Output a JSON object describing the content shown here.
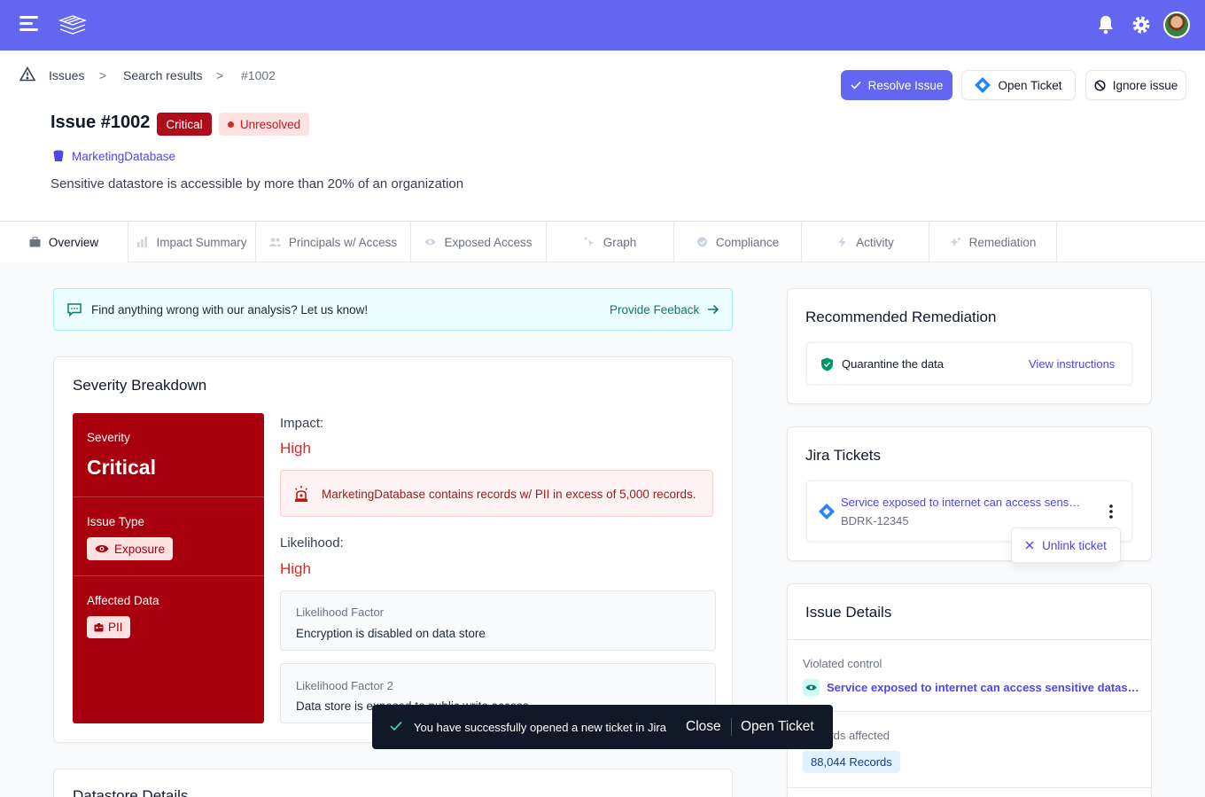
{
  "breadcrumb": {
    "items": [
      "Issues",
      "Search results",
      "#1002"
    ],
    "sep": ">"
  },
  "actions": {
    "resolve": "Resolve Issue",
    "open_ticket": "Open Ticket",
    "ignore": "Ignore issue"
  },
  "issue": {
    "title": "Issue #1002",
    "severity_badge": "Critical",
    "status_badge": "Unresolved",
    "datastore": "MarketingDatabase",
    "description": "Sensitive datastore is accessible by more than 20% of an organization"
  },
  "tabs": [
    "Overview",
    "Impact Summary",
    "Principals w/ Access",
    "Exposed Access",
    "Graph",
    "Compliance",
    "Activity",
    "Remediation"
  ],
  "feedback": {
    "text": "Find anything wrong with our analysis? Let us know!",
    "link": "Provide Feeback"
  },
  "severity": {
    "title": "Severity Breakdown",
    "label": "Severity",
    "value": "Critical",
    "issue_type_label": "Issue Type",
    "issue_type": "Exposure",
    "affected_label": "Affected Data",
    "affected": "PII",
    "impact_label": "Impact:",
    "impact_value": "High",
    "impact_detail": "MarketingDatabase contains records w/ PII in excess of 5,000 records.",
    "likelihood_label": "Likelihood:",
    "likelihood_value": "High",
    "factors": [
      {
        "label": "Likelihood Factor",
        "text": "Encryption is disabled on data store"
      },
      {
        "label": "Likelihood Factor 2",
        "text": "Data store is exposed to public write access"
      }
    ]
  },
  "datastore_card": {
    "title": "Datastore Details"
  },
  "remediation": {
    "title": "Recommended Remediation",
    "item": "Quarantine the data",
    "link": "View instructions"
  },
  "jira": {
    "title": "Jira Tickets",
    "ticket_title": "Service exposed to internet can access sens…",
    "ticket_id": "BDRK-12345",
    "unlink": "Unlink ticket"
  },
  "details": {
    "title": "Issue Details",
    "violated_label": "Violated control",
    "violated_value": "Service exposed to internet can access sensitive datas…",
    "records_label": "Records affected",
    "records_value": "88,044 Records"
  },
  "toast": {
    "message": "You have successfully opened a new ticket in Jira",
    "close": "Close",
    "open": "Open Ticket"
  },
  "colors": {
    "brand": "#6366f1",
    "critical": "#a8000f",
    "danger": "#dc2626",
    "link": "#4f46e5",
    "success": "#16a34a"
  }
}
